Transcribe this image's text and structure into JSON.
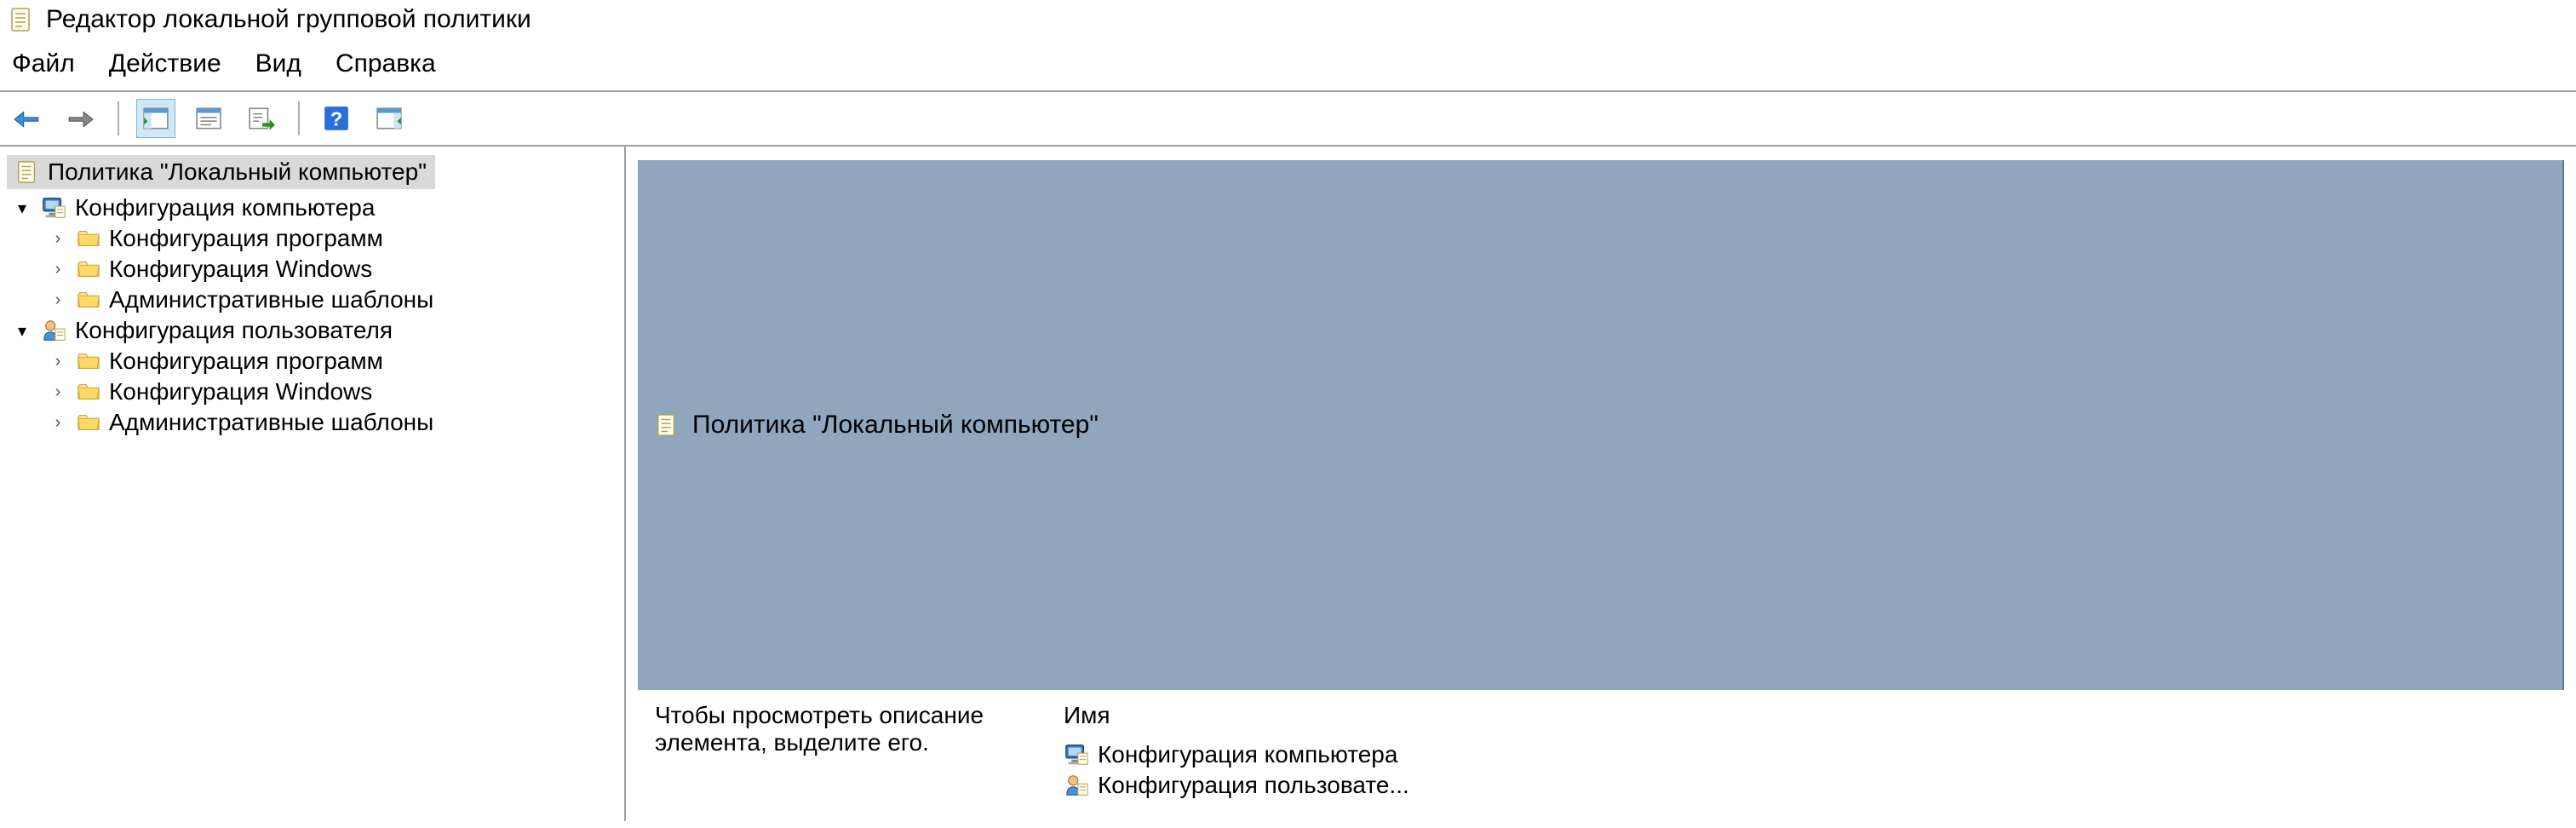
{
  "window": {
    "title": "Редактор локальной групповой политики"
  },
  "menu": {
    "file": "Файл",
    "action": "Действие",
    "view": "Вид",
    "help": "Справка"
  },
  "tree": {
    "root": "Политика \"Локальный компьютер\"",
    "computer": {
      "label": "Конфигурация компьютера",
      "children": {
        "software": "Конфигурация программ",
        "windows": "Конфигурация Windows",
        "admin": "Административные шаблоны"
      }
    },
    "user": {
      "label": "Конфигурация пользователя",
      "children": {
        "software": "Конфигурация программ",
        "windows": "Конфигурация Windows",
        "admin": "Административные шаблоны"
      }
    }
  },
  "detail": {
    "header": "Политика \"Локальный компьютер\"",
    "description": "Чтобы просмотреть описание элемента, выделите его.",
    "column_name": "Имя",
    "items": {
      "computer": "Конфигурация компьютера",
      "user": "Конфигурация пользовате..."
    }
  }
}
